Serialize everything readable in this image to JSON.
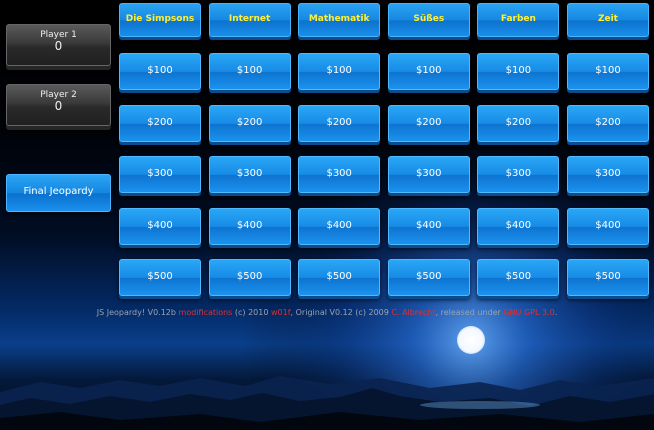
{
  "players": [
    {
      "name": "Player 1",
      "score": "0"
    },
    {
      "name": "Player 2",
      "score": "0"
    }
  ],
  "final_label": "Final Jeopardy",
  "categories": [
    {
      "title": "Die Simpsons",
      "values": [
        "$100",
        "$200",
        "$300",
        "$400",
        "$500"
      ]
    },
    {
      "title": "Internet",
      "values": [
        "$100",
        "$200",
        "$300",
        "$400",
        "$500"
      ]
    },
    {
      "title": "Mathematik",
      "values": [
        "$100",
        "$200",
        "$300",
        "$400",
        "$500"
      ]
    },
    {
      "title": "Süßes",
      "values": [
        "$100",
        "$200",
        "$300",
        "$400",
        "$500"
      ]
    },
    {
      "title": "Farben",
      "values": [
        "$100",
        "$200",
        "$300",
        "$400",
        "$500"
      ]
    },
    {
      "title": "Zeit",
      "values": [
        "$100",
        "$200",
        "$300",
        "$400",
        "$500"
      ]
    }
  ],
  "footer": {
    "t1": "JS Jeopardy! V0.12b ",
    "link1": "modifications",
    "t2": " (c) 2010 ",
    "link2": "w01f",
    "t3": ", Original V0.12 (c) 2009 ",
    "link3": "C. Albrecht",
    "t4": ", released under ",
    "link4": "GNU GPL 3.0",
    "t5": "."
  },
  "colors": {
    "tile_blue": "#178be5",
    "category_text": "#ffee33",
    "link_red": "#e03030",
    "footer_text": "#9aa3ad"
  }
}
